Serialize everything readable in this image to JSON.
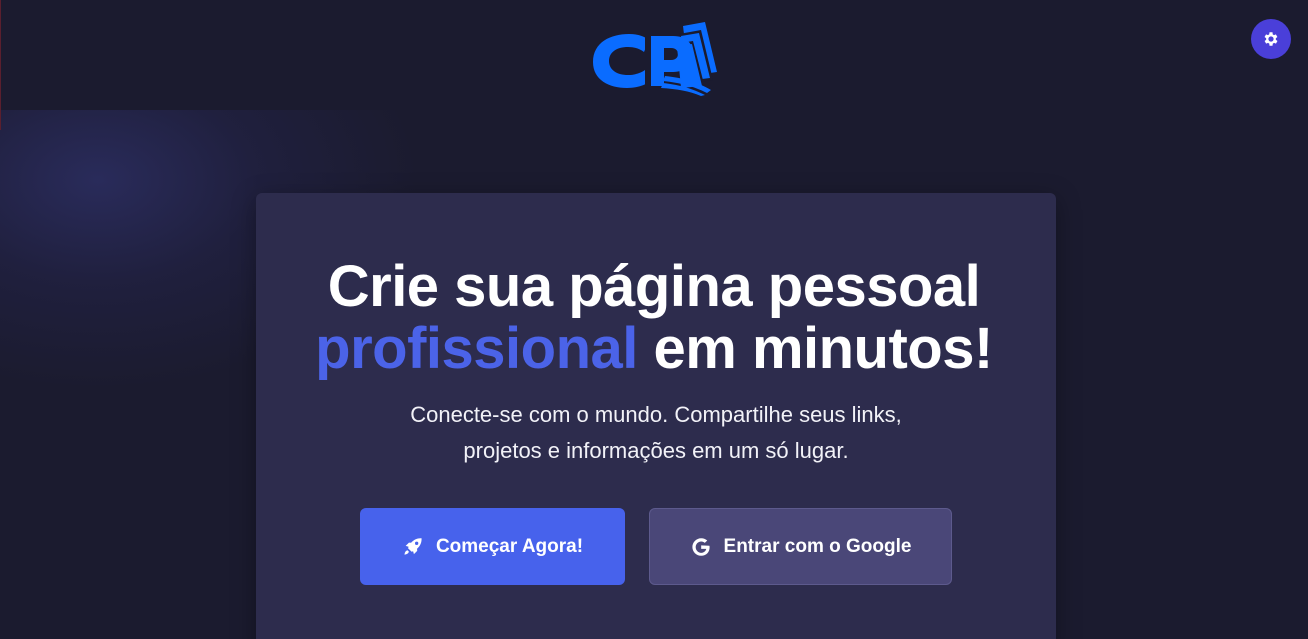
{
  "brand": {
    "logo_text": "CP",
    "logo_color": "#0a6cff"
  },
  "header": {
    "settings_icon": "gear-icon",
    "settings_color": "#4a3fd9"
  },
  "hero": {
    "title_line1": "Crie sua página pessoal",
    "title_accent": "profissional",
    "title_line2_rest": " em minutos!",
    "subtitle_line1": "Conecte-se com o mundo. Compartilhe seus links,",
    "subtitle_line2": "projetos e informações em um só lugar.",
    "accent_color": "#4b63e8"
  },
  "actions": {
    "primary": {
      "label": "Começar Agora!",
      "icon": "rocket-icon",
      "color": "#4762ec"
    },
    "google": {
      "label": "Entrar com o Google",
      "icon": "google-icon",
      "color": "#4a4778"
    }
  }
}
